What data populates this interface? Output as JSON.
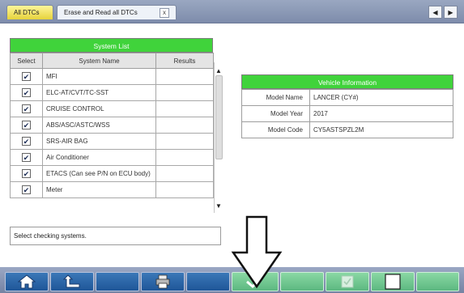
{
  "tabs": [
    {
      "label": "All DTCs"
    },
    {
      "label": "Erase and Read all DTCs",
      "close": "x"
    }
  ],
  "nav": {
    "prev": "◀",
    "next": "▶"
  },
  "system_list": {
    "title": "System List",
    "columns": [
      "Select",
      "System Name",
      "Results"
    ],
    "rows": [
      {
        "checked": true,
        "name": "MFI",
        "result": ""
      },
      {
        "checked": true,
        "name": "ELC-AT/CVT/TC-SST",
        "result": ""
      },
      {
        "checked": true,
        "name": "CRUISE CONTROL",
        "result": ""
      },
      {
        "checked": true,
        "name": "ABS/ASC/ASTC/WSS",
        "result": ""
      },
      {
        "checked": true,
        "name": "SRS-AIR BAG",
        "result": ""
      },
      {
        "checked": true,
        "name": "Air Conditioner",
        "result": ""
      },
      {
        "checked": true,
        "name": "ETACS (Can see P/N on ECU body)",
        "result": ""
      },
      {
        "checked": true,
        "name": "Meter",
        "result": ""
      }
    ],
    "check_mark": "✔",
    "scroll_up": "▲",
    "scroll_down": "▼"
  },
  "vehicle_info": {
    "title": "Vehicle Information",
    "rows": [
      {
        "label": "Model Name",
        "value": "LANCER (CY#)"
      },
      {
        "label": "Model Year",
        "value": "2017"
      },
      {
        "label": "Model Code",
        "value": "CY5ASTSPZL2M"
      }
    ]
  },
  "status_text": "Select checking systems.",
  "colors": {
    "accent_green": "#40d33b",
    "toolbar_blue": "#2a66a8",
    "toolbar_green": "#6fc68f"
  },
  "toolbar_icons": [
    "home-icon",
    "back-icon",
    "print-icon",
    "confirm-check-icon",
    "select-all-icon",
    "deselect-all-icon"
  ]
}
